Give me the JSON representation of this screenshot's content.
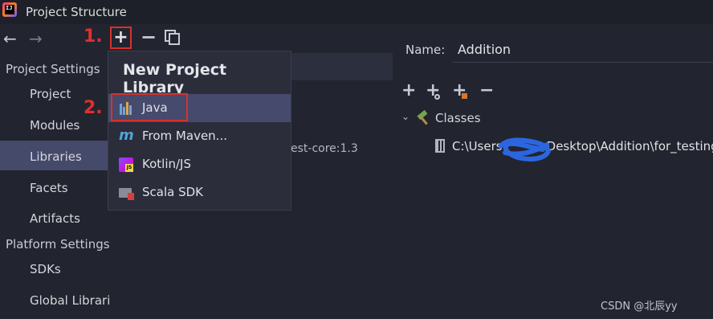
{
  "window": {
    "title": "Project Structure"
  },
  "toolbar": {
    "back_icon": "←",
    "forward_icon": "→",
    "add_icon": "+",
    "remove_icon": "−",
    "copy_icon": "copy-icon"
  },
  "annotations": {
    "step1": "1.",
    "step2": "2."
  },
  "sidebar": {
    "project_settings_header": "Project Settings",
    "project_items": [
      "Project",
      "Modules",
      "Libraries",
      "Facets",
      "Artifacts"
    ],
    "platform_settings_header": "Platform Settings",
    "platform_items": [
      "SDKs",
      "Global Librari"
    ],
    "selected": "Libraries"
  },
  "library_list": {
    "partial_entry": "est-core:1.3"
  },
  "popup": {
    "title": "New Project Library",
    "items": [
      {
        "label": "Java",
        "icon": "java-library-icon",
        "selected": true
      },
      {
        "label": "From Maven...",
        "icon": "maven-icon",
        "selected": false
      },
      {
        "label": "Kotlin/JS",
        "icon": "kotlin-js-icon",
        "selected": false
      },
      {
        "label": "Scala SDK",
        "icon": "scala-sdk-icon",
        "selected": false
      }
    ]
  },
  "detail": {
    "name_label": "Name:",
    "name_value": "Addition",
    "toolbar_icons": [
      "+",
      "+",
      "+",
      "−"
    ],
    "tree_toggle": "⌄",
    "classes_label": "Classes",
    "path_prefix": "C:\\Users\\",
    "path_suffix": "Desktop\\Addition\\for_testing"
  },
  "watermark": "CSDN @北辰yy",
  "colors": {
    "background": "#22242f",
    "selection": "#45496a",
    "popup_bg": "#2b2d3b",
    "annotation_red": "#d8312c"
  }
}
